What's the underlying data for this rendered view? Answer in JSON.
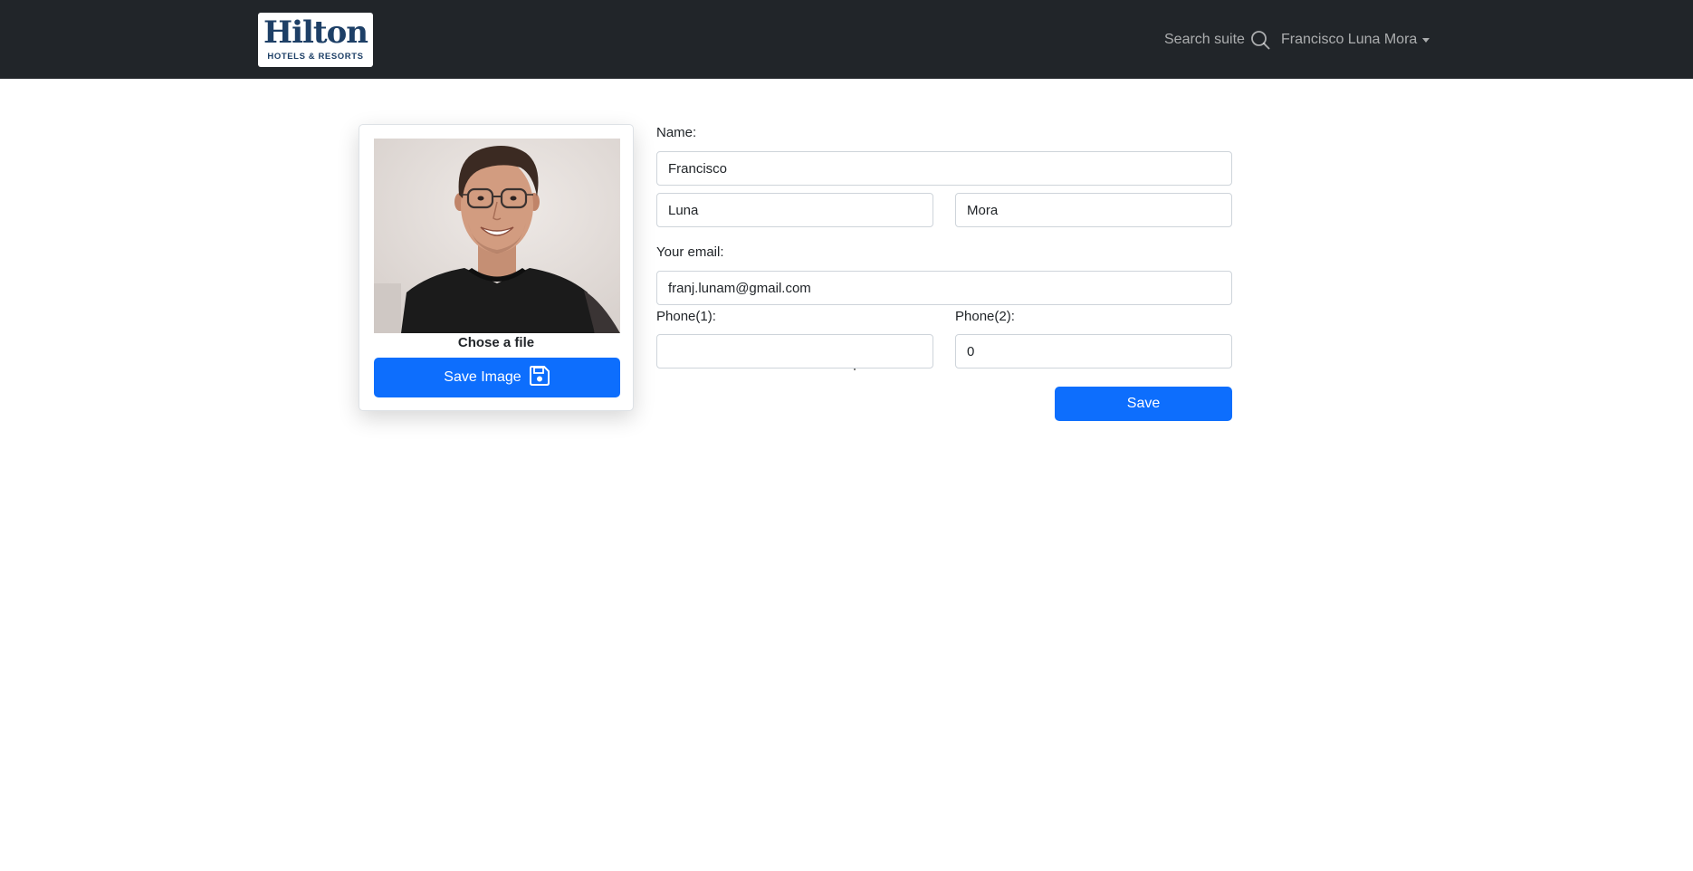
{
  "navbar": {
    "logo_title": "Hilton",
    "logo_subtitle": "HOTELS & RESORTS",
    "search_label": "Search suite",
    "search_icon": "search-icon",
    "user_name": "Francisco Luna Mora"
  },
  "profile_card": {
    "photo_alt": "Profile photo",
    "chose_file_label": "Chose a file",
    "save_image_label": "Save Image",
    "save_image_icon": "floppy-disk-icon"
  },
  "form": {
    "name_label": "Name:",
    "first_name": "Francisco",
    "last_name_1": "Luna",
    "last_name_2": "Mora",
    "email_label": "Your email:",
    "email": "franj.lunam@gmail.com",
    "phone1_label": "Phone(1):",
    "phone1": "",
    "phone2_label": "Phone(2):",
    "phone2": "0",
    "save_label": "Save"
  },
  "colors": {
    "navbar_bg": "#212529",
    "primary": "#0d6efd",
    "brand_navy": "#1d3f66"
  }
}
